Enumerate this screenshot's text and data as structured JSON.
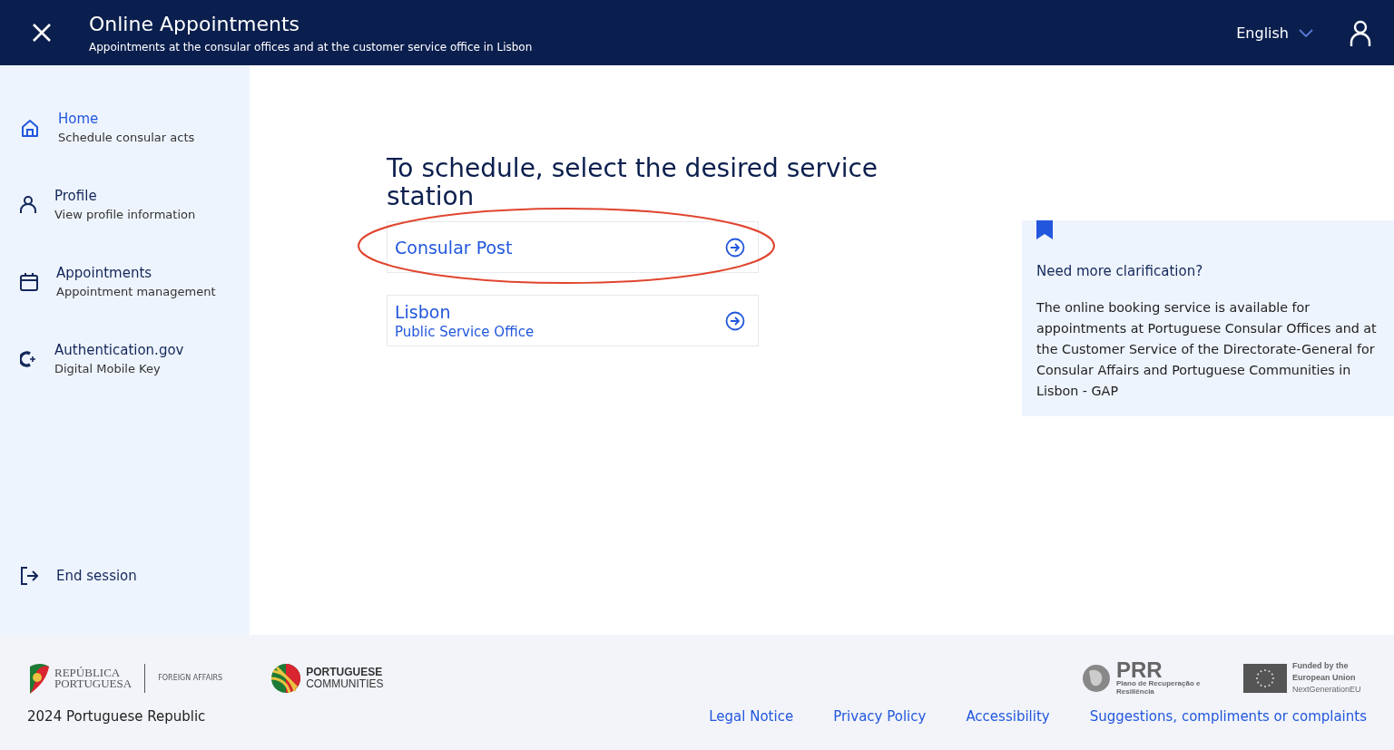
{
  "header": {
    "title": "Online Appointments",
    "subtitle": "Appointments at the consular offices and at the customer service office in Lisbon",
    "language": "English"
  },
  "sidebar": {
    "items": [
      {
        "kind": "home",
        "title": "Home",
        "subtitle": "Schedule consular acts",
        "selected": true
      },
      {
        "kind": "profile",
        "title": "Profile",
        "subtitle": "View profile information",
        "selected": false
      },
      {
        "kind": "calendar",
        "title": "Appointments",
        "subtitle": "Appointment management",
        "selected": false
      },
      {
        "kind": "key",
        "title": "Authentication.gov",
        "subtitle": "Digital Mobile Key",
        "selected": false
      }
    ],
    "end_session": "End session"
  },
  "main": {
    "heading": "To schedule, select the desired service station",
    "options": [
      {
        "title": "Consular Post",
        "highlighted": true
      },
      {
        "title": "Lisbon",
        "subtitle": "Public Service Office",
        "highlighted": false
      }
    ]
  },
  "info": {
    "title": "Need more clarification?",
    "text": "The online booking service is available for appointments at Portuguese Consular Offices and at the Customer Service of the Directorate-General for Consular Affairs and Portuguese Communities in Lisbon - GAP"
  },
  "footer": {
    "republic_logo": [
      "REPÚBLICA",
      "PORTUGUESA"
    ],
    "ministry": "FOREIGN AFFAIRS",
    "communities_logo": [
      "PORTUGUESE",
      "COMMUNITIES"
    ],
    "prr_logo": [
      "PRR",
      "Plano de Recuperação e Resiliência"
    ],
    "eu_logo": [
      "Funded by the European Union",
      "NextGenerationEU"
    ],
    "copyright": "2024 Portuguese Republic",
    "links": [
      "Legal Notice",
      "Privacy Policy",
      "Accessibility",
      "Suggestions, compliments or complaints"
    ]
  }
}
